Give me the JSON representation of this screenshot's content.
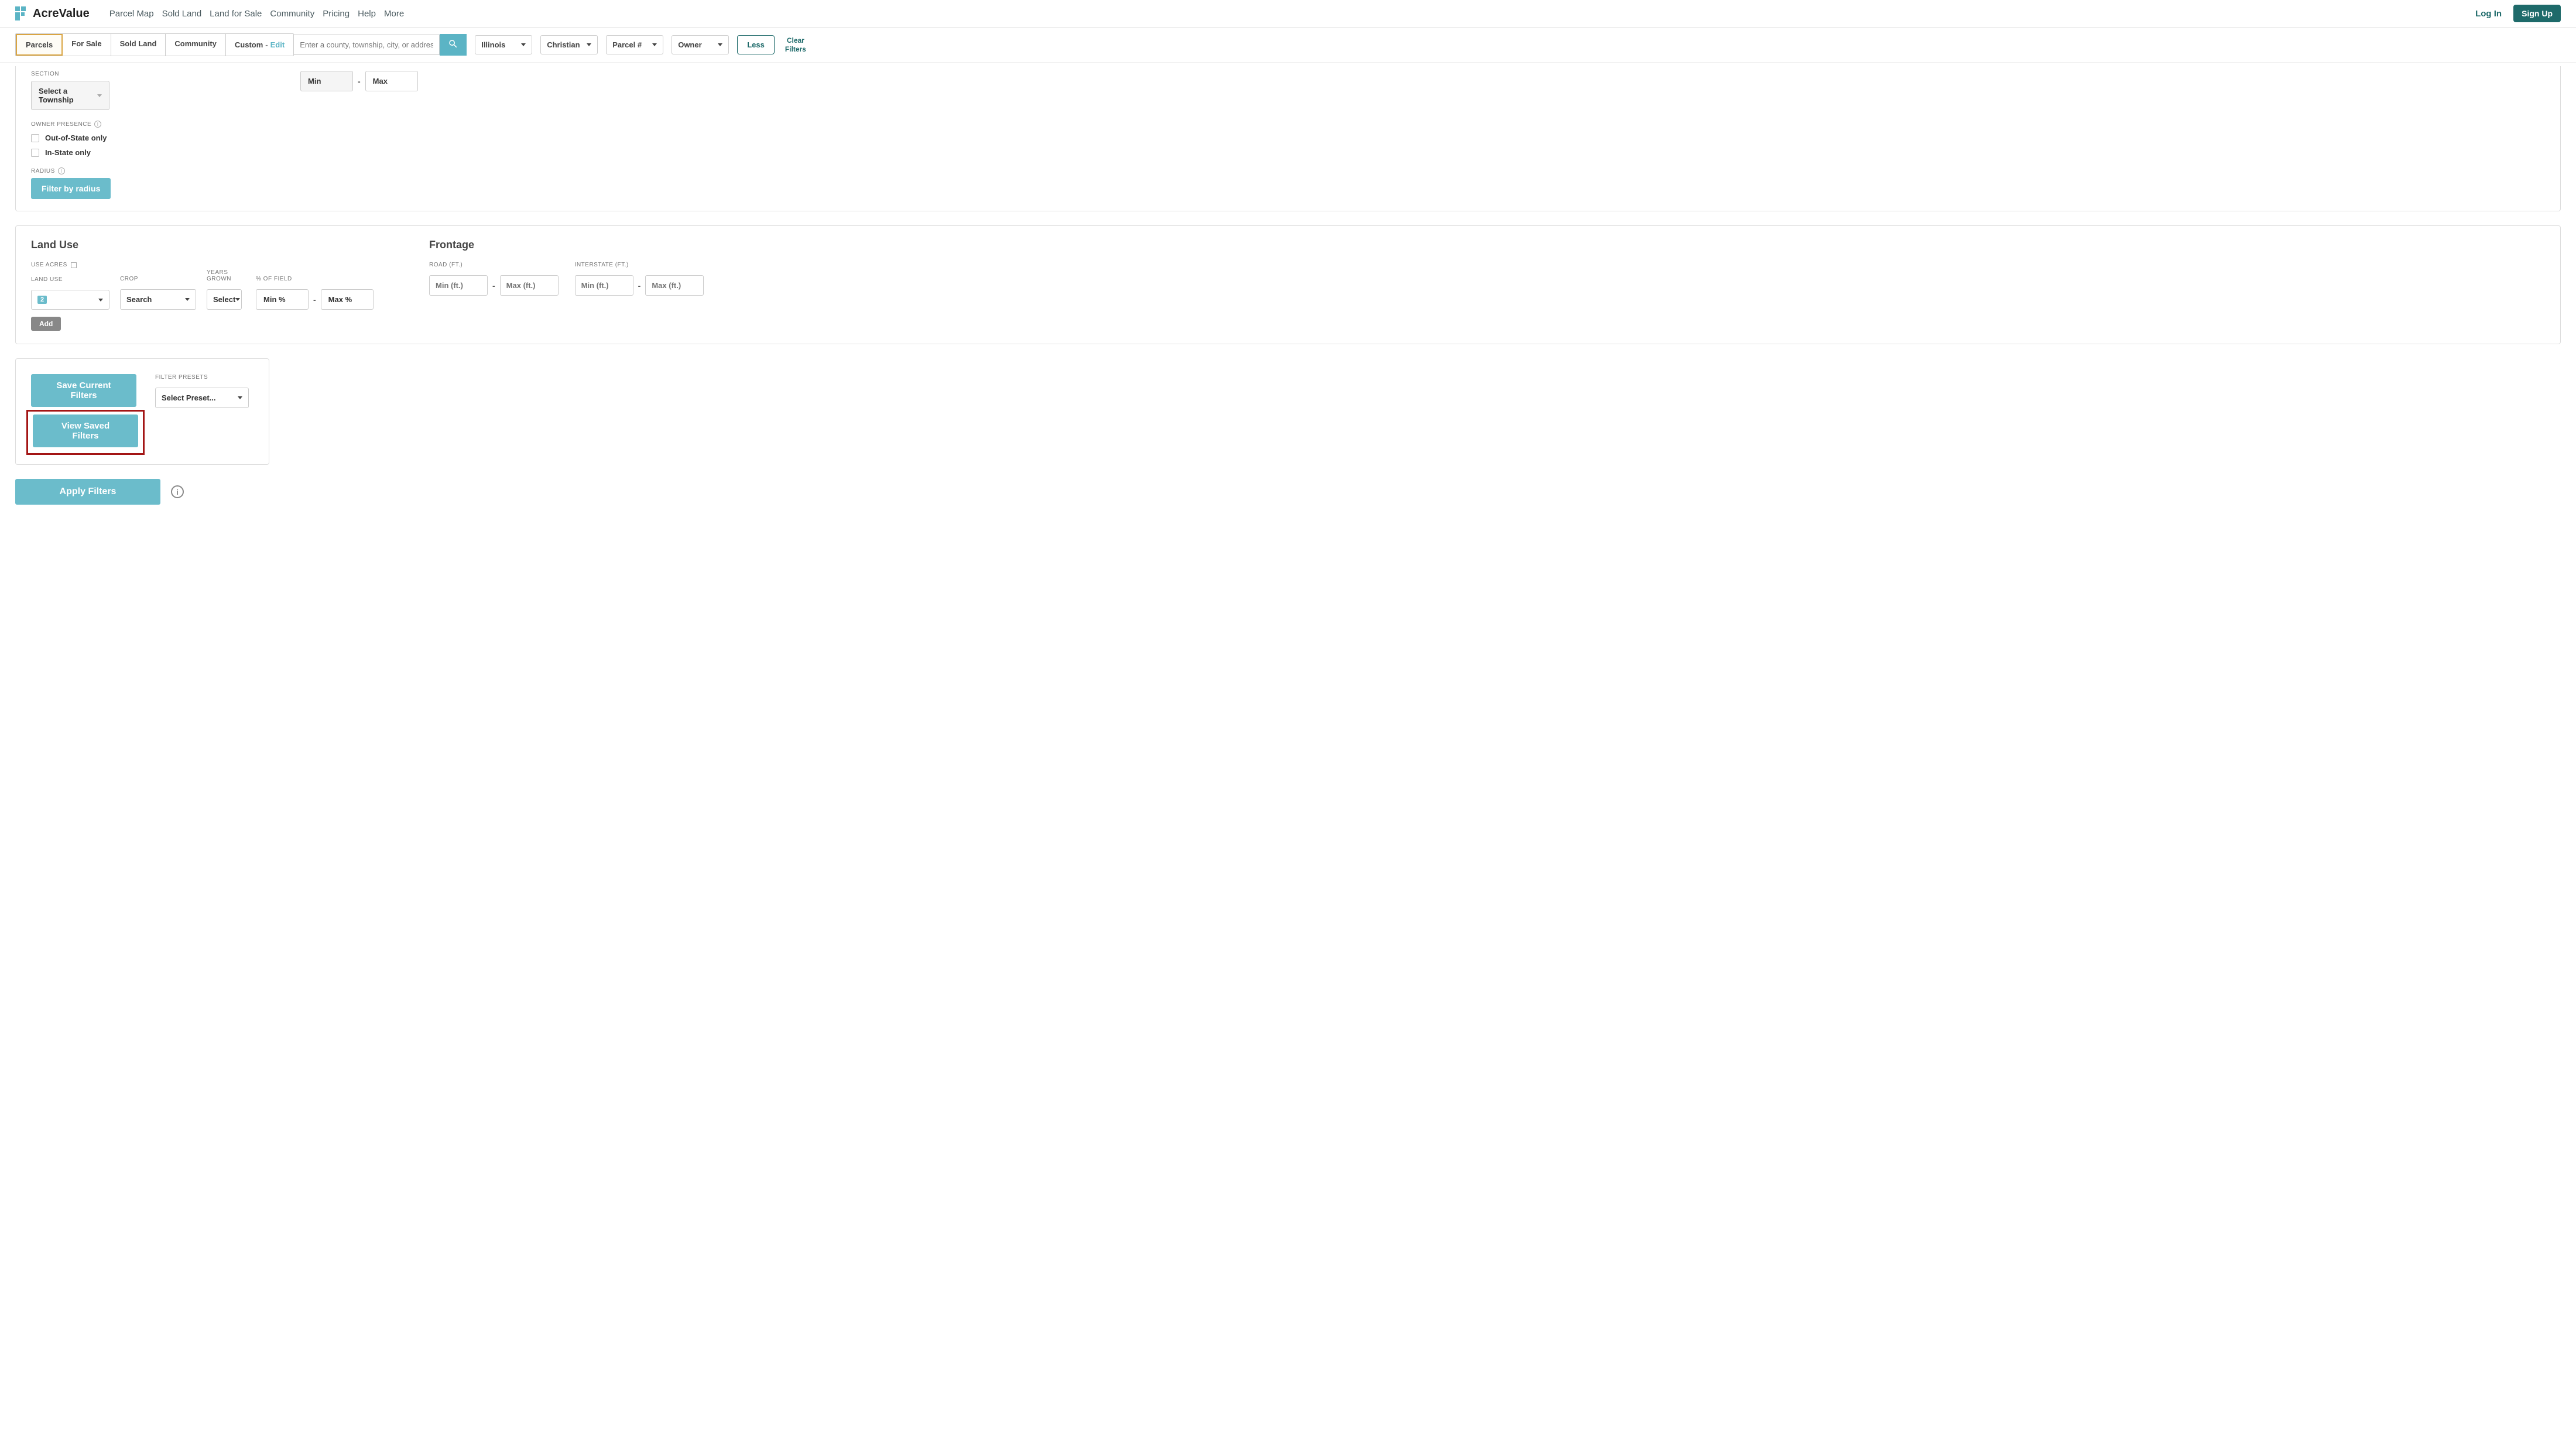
{
  "header": {
    "logo_text": "AcreValue",
    "nav": [
      "Parcel Map",
      "Sold Land",
      "Land for Sale",
      "Community",
      "Pricing",
      "Help",
      "More"
    ],
    "login": "Log In",
    "signup": "Sign Up"
  },
  "filter_bar": {
    "tabs": {
      "parcels": "Parcels",
      "for_sale": "For Sale",
      "sold_land": "Sold Land",
      "community": "Community",
      "custom": "Custom",
      "custom_dash": "-",
      "custom_edit": "Edit"
    },
    "search_placeholder": "Enter a county, township, city, or address",
    "dropdowns": {
      "state": "Illinois",
      "county": "Christian",
      "parcel": "Parcel #",
      "owner": "Owner"
    },
    "less": "Less",
    "clear_l1": "Clear",
    "clear_l2": "Filters"
  },
  "top_panel": {
    "section_label": "SECTION",
    "section_value": "Select a Township",
    "owner_presence_label": "OWNER PRESENCE",
    "cb_out": "Out-of-State only",
    "cb_in": "In-State only",
    "radius_label": "RADIUS",
    "radius_btn": "Filter by radius",
    "min": "Min",
    "max": "Max"
  },
  "land_use": {
    "title": "Land Use",
    "use_acres": "USE ACRES",
    "land_use_label": "LAND USE",
    "land_use_badge": "2",
    "crop_label": "CROP",
    "crop_value": "Search",
    "years_label": "YEARS GROWN",
    "years_value": "Select",
    "pct_label": "% OF FIELD",
    "pct_min": "Min %",
    "pct_max": "Max %",
    "add": "Add"
  },
  "frontage": {
    "title": "Frontage",
    "road_label": "ROAD (FT.)",
    "interstate_label": "INTERSTATE (FT.)",
    "min_ft": "Min (ft.)",
    "max_ft": "Max (ft.)"
  },
  "presets": {
    "save": "Save Current Filters",
    "view": "View Saved Filters",
    "label": "FILTER PRESETS",
    "select": "Select Preset..."
  },
  "apply": "Apply Filters"
}
